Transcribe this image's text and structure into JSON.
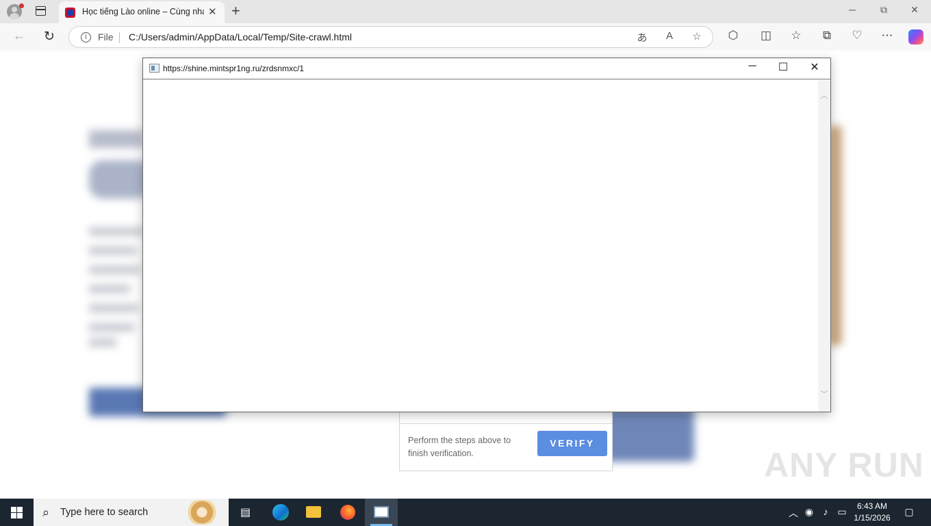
{
  "browser": {
    "tab_title": "Học tiếng Lào online – Cùng nhau",
    "address_scheme": "File",
    "address_url": "C:/Users/admin/AppData/Local/Temp/Site-crawl.html",
    "window_minimize": "─",
    "window_restore": "⧉",
    "window_close": "✕"
  },
  "popup": {
    "url": "https://shine.mintspr1ng.ru/zrdsnmxc/1",
    "minimize": "─",
    "maximize": "☐",
    "close": "✕"
  },
  "verification": {
    "text": "Perform the steps above to finish verification.",
    "button_label": "VERIFY"
  },
  "watermark": "ANY RUN",
  "taskbar": {
    "search_placeholder": "Type here to search",
    "time": "6:43 AM",
    "date": "1/15/2026"
  },
  "colors": {
    "verify_button": "#5b8de0",
    "taskbar": "#1c2631",
    "active_app_indicator": "#76b9ed"
  }
}
